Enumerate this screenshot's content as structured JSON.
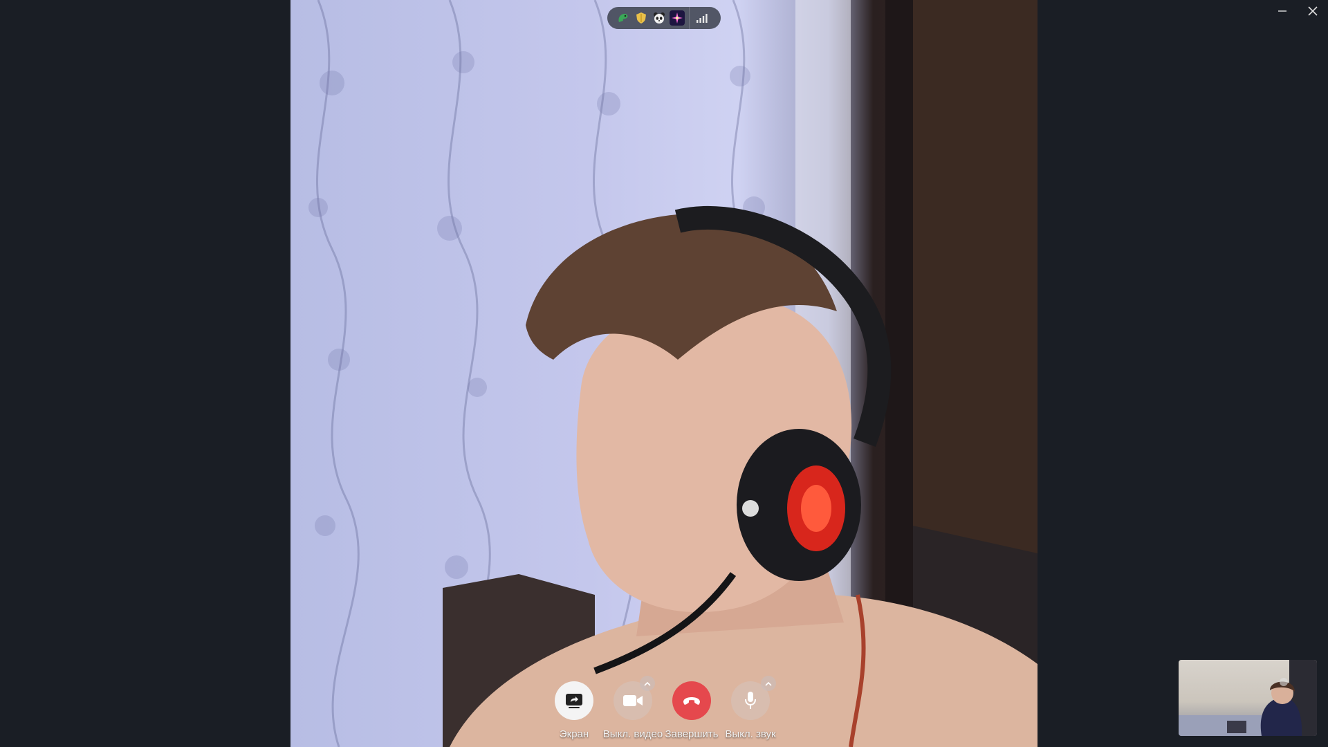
{
  "window": {
    "minimize_icon": "minimize-icon",
    "close_icon": "close-icon"
  },
  "status_bar": {
    "encryption_emojis": [
      "dragon-emoji",
      "shield-emoji",
      "panda-emoji",
      "sparkle-emoji"
    ],
    "signal_icon": "signal-bars-icon"
  },
  "controls": {
    "screen_label": "Экран",
    "video_label": "Выкл. видео",
    "end_label": "Завершить",
    "mic_label": "Выкл. звук"
  },
  "colors": {
    "background": "#1a1e25",
    "end_call": "#e5484d",
    "control_light": "#f4f4f4"
  }
}
